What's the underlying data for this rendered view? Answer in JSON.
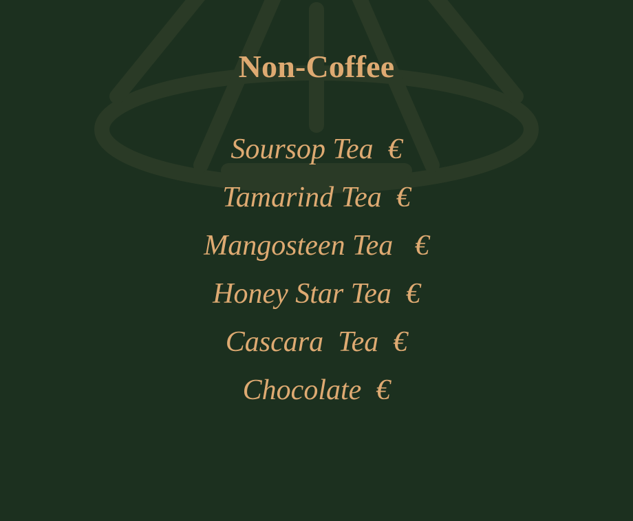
{
  "colors": {
    "background": "#1c301f",
    "accent": "#deaa72",
    "watermark": "#2a3a26"
  },
  "watermark": {
    "icon": "coffee-funnel-logo-icon"
  },
  "menu": {
    "title": "Non-Coffee",
    "items": [
      {
        "label": "Soursop Tea  €"
      },
      {
        "label": "Tamarind Tea  €"
      },
      {
        "label": "Mangosteen Tea   €"
      },
      {
        "label": "Honey Star Tea  €"
      },
      {
        "label": "Cascara  Tea  €"
      },
      {
        "label": "Chocolate  €"
      }
    ]
  }
}
